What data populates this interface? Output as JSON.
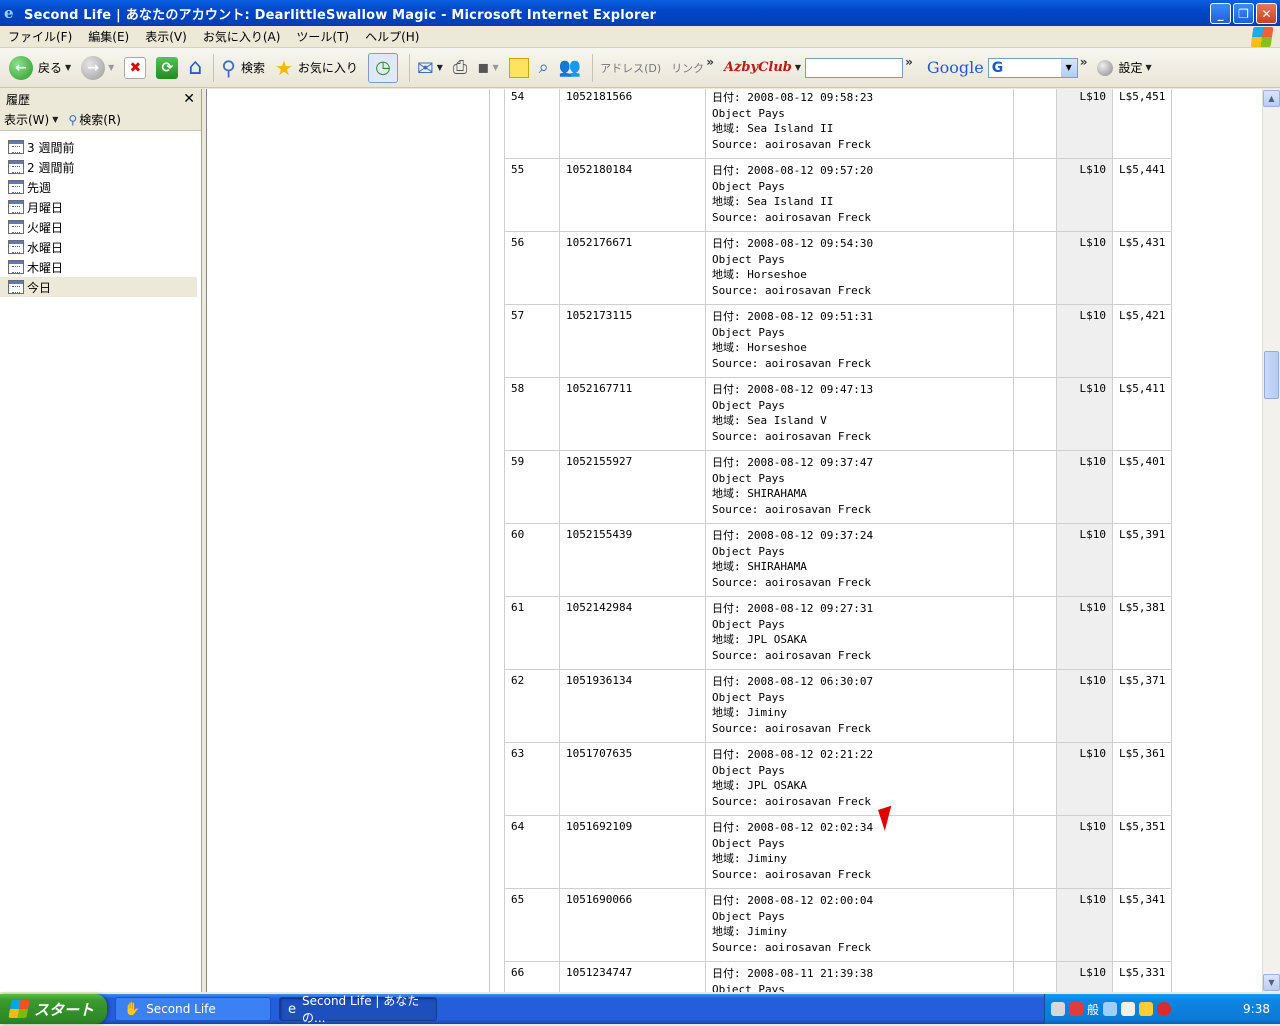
{
  "window": {
    "title": "Second Life | あなたのアカウント: DearlittleSwallow Magic - Microsoft Internet Explorer"
  },
  "menu": [
    "ファイル(F)",
    "編集(E)",
    "表示(V)",
    "お気に入り(A)",
    "ツール(T)",
    "ヘルプ(H)"
  ],
  "toolbar": {
    "back": "戻る",
    "search": "検索",
    "favorites": "お気に入り",
    "address": "アドレス(D)",
    "links": "リンク",
    "azby": "AzbyClub",
    "google": "Google",
    "google_select": "G",
    "settings": "設定"
  },
  "history": {
    "title": "履歴",
    "view": "表示(W)",
    "search": "検索(R)",
    "items": [
      "3 週間前",
      "2 週間前",
      "先週",
      "月曜日",
      "火曜日",
      "水曜日",
      "木曜日",
      "今日"
    ],
    "selected_index": 7
  },
  "transactions": [
    {
      "num": "54",
      "id": "1052181566",
      "date": "日付: 2008-08-12 09:58:23",
      "type": "Object Pays",
      "region": "地域: Sea Island II",
      "source": "Source: aoirosavan Freck",
      "amount": "L$10",
      "balance": "L$5,451"
    },
    {
      "num": "55",
      "id": "1052180184",
      "date": "日付: 2008-08-12 09:57:20",
      "type": "Object Pays",
      "region": "地域: Sea Island II",
      "source": "Source: aoirosavan Freck",
      "amount": "L$10",
      "balance": "L$5,441"
    },
    {
      "num": "56",
      "id": "1052176671",
      "date": "日付: 2008-08-12 09:54:30",
      "type": "Object Pays",
      "region": "地域: Horseshoe",
      "source": "Source: aoirosavan Freck",
      "amount": "L$10",
      "balance": "L$5,431"
    },
    {
      "num": "57",
      "id": "1052173115",
      "date": "日付: 2008-08-12 09:51:31",
      "type": "Object Pays",
      "region": "地域: Horseshoe",
      "source": "Source: aoirosavan Freck",
      "amount": "L$10",
      "balance": "L$5,421"
    },
    {
      "num": "58",
      "id": "1052167711",
      "date": "日付: 2008-08-12 09:47:13",
      "type": "Object Pays",
      "region": "地域: Sea Island V",
      "source": "Source: aoirosavan Freck",
      "amount": "L$10",
      "balance": "L$5,411"
    },
    {
      "num": "59",
      "id": "1052155927",
      "date": "日付: 2008-08-12 09:37:47",
      "type": "Object Pays",
      "region": "地域: SHIRAHAMA",
      "source": "Source: aoirosavan Freck",
      "amount": "L$10",
      "balance": "L$5,401"
    },
    {
      "num": "60",
      "id": "1052155439",
      "date": "日付: 2008-08-12 09:37:24",
      "type": "Object Pays",
      "region": "地域: SHIRAHAMA",
      "source": "Source: aoirosavan Freck",
      "amount": "L$10",
      "balance": "L$5,391"
    },
    {
      "num": "61",
      "id": "1052142984",
      "date": "日付: 2008-08-12 09:27:31",
      "type": "Object Pays",
      "region": "地域: JPL OSAKA",
      "source": "Source: aoirosavan Freck",
      "amount": "L$10",
      "balance": "L$5,381"
    },
    {
      "num": "62",
      "id": "1051936134",
      "date": "日付: 2008-08-12 06:30:07",
      "type": "Object Pays",
      "region": "地域: Jiminy",
      "source": "Source: aoirosavan Freck",
      "amount": "L$10",
      "balance": "L$5,371"
    },
    {
      "num": "63",
      "id": "1051707635",
      "date": "日付: 2008-08-12 02:21:22",
      "type": "Object Pays",
      "region": "地域: JPL OSAKA",
      "source": "Source: aoirosavan Freck",
      "amount": "L$10",
      "balance": "L$5,361"
    },
    {
      "num": "64",
      "id": "1051692109",
      "date": "日付: 2008-08-12 02:02:34",
      "type": "Object Pays",
      "region": "地域: Jiminy",
      "source": "Source: aoirosavan Freck",
      "amount": "L$10",
      "balance": "L$5,351"
    },
    {
      "num": "65",
      "id": "1051690066",
      "date": "日付: 2008-08-12 02:00:04",
      "type": "Object Pays",
      "region": "地域: Jiminy",
      "source": "Source: aoirosavan Freck",
      "amount": "L$10",
      "balance": "L$5,341"
    },
    {
      "num": "66",
      "id": "1051234747",
      "date": "日付: 2008-08-11 21:39:38",
      "type": "Object Pays",
      "region": "",
      "source": "",
      "amount": "L$10",
      "balance": "L$5,331"
    }
  ],
  "taskbar": {
    "start": "スタート",
    "tasks": [
      "Second Life",
      "Second Life | あなたの..."
    ],
    "ime": "般",
    "clock": "9:38"
  }
}
